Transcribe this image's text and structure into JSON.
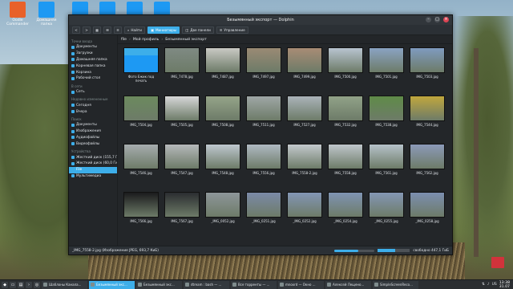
{
  "desktop": {
    "icons": [
      {
        "label": "Oodle Commander",
        "color": "#e8612a"
      },
      {
        "label": "Домашняя папка",
        "color": "#1d99f3"
      },
      {
        "label": "",
        "color": "#1d99f3"
      },
      {
        "label": "",
        "color": "#1d99f3"
      },
      {
        "label": "",
        "color": "#1d99f3"
      },
      {
        "label": "",
        "color": "#1d99f3"
      }
    ]
  },
  "window": {
    "title": "Безымянный экспорт — Dolphin",
    "toolbar": {
      "back": "<",
      "forward": ">",
      "find": "Найти",
      "preview": "Миниатюры",
      "split": "Две панели",
      "control": "Управление"
    },
    "breadcrumb": [
      "file",
      "Мой профиль",
      "Безымянный экспорт"
    ],
    "sidebar": [
      {
        "type": "head",
        "label": "Точки входа"
      },
      {
        "type": "item",
        "label": "Документы"
      },
      {
        "type": "item",
        "label": "Загрузки"
      },
      {
        "type": "item",
        "label": "Домашняя папка"
      },
      {
        "type": "item",
        "label": "Корневая папка"
      },
      {
        "type": "item",
        "label": "Корзина"
      },
      {
        "type": "item",
        "label": "Рабочий стол"
      },
      {
        "type": "head",
        "label": "В сети"
      },
      {
        "type": "item",
        "label": "Сеть"
      },
      {
        "type": "head",
        "label": "Недавно измененные"
      },
      {
        "type": "item",
        "label": "Сегодня"
      },
      {
        "type": "item",
        "label": "Вчера"
      },
      {
        "type": "head",
        "label": "Поиск"
      },
      {
        "type": "item",
        "label": "Документы"
      },
      {
        "type": "item",
        "label": "Изображения"
      },
      {
        "type": "item",
        "label": "Аудиофайлы"
      },
      {
        "type": "item",
        "label": "Видеофайлы"
      },
      {
        "type": "head",
        "label": "Устройства"
      },
      {
        "type": "item",
        "label": "Жесткий диск (155,7 ГиБ)"
      },
      {
        "type": "item",
        "label": "Жесткий диск (60,0 ГиБ)"
      },
      {
        "type": "item",
        "label": "File",
        "selected": true
      },
      {
        "type": "item",
        "label": "Мультимедиа"
      }
    ],
    "files": [
      {
        "name": "Фото Ежик под печать",
        "folder": true
      },
      {
        "name": "IMG_7478.jpg",
        "color": "#7f8a83"
      },
      {
        "name": "IMG_7487.jpg",
        "color": "#c9c9c4"
      },
      {
        "name": "IMG_7497.jpg",
        "color": "#9a8a74"
      },
      {
        "name": "IMG_7499.jpg",
        "color": "#a88c75"
      },
      {
        "name": "IMG_7500.jpg",
        "color": "#b8c4d0"
      },
      {
        "name": "IMG_7501.jpg",
        "color": "#8aa3c2"
      },
      {
        "name": "IMG_7503.jpg",
        "color": "#7f9bbf"
      },
      {
        "name": "IMG_7504.jpg",
        "color": "#6c8a5e"
      },
      {
        "name": "IMG_7505.jpg",
        "color": "#d6d7d8"
      },
      {
        "name": "IMG_7508.jpg",
        "color": "#95a489"
      },
      {
        "name": "IMG_7511.jpg",
        "color": "#9fa7a6"
      },
      {
        "name": "IMG_7527.jpg",
        "color": "#aab3b9"
      },
      {
        "name": "IMG_7532.jpg",
        "color": "#91a288"
      },
      {
        "name": "IMG_7538.jpg",
        "color": "#5f8b48"
      },
      {
        "name": "IMG_7544.jpg",
        "color": "#c0a73d"
      },
      {
        "name": "IMG_7546.jpg",
        "color": "#a6acae"
      },
      {
        "name": "IMG_7547.jpg",
        "color": "#b5b8ba"
      },
      {
        "name": "IMG_7548.jpg",
        "color": "#bec7cf"
      },
      {
        "name": "IMG_7556.jpg",
        "color": "#afb9c2"
      },
      {
        "name": "IMG_7558-2.jpg",
        "color": "#c3c9cd"
      },
      {
        "name": "IMG_7558.jpg",
        "color": "#bfc6cb"
      },
      {
        "name": "IMG_7561.jpg",
        "color": "#b6c2ca"
      },
      {
        "name": "IMG_7562.jpg",
        "color": "#8c9ab8"
      },
      {
        "name": "IMG_7566.jpg",
        "color": "#1b1b1d"
      },
      {
        "name": "IMG_7567.jpg",
        "color": "#2b2d30"
      },
      {
        "name": "_IMG_0052.jpg",
        "color": "#8e969a"
      },
      {
        "name": "_IMG_0251.jpg",
        "color": "#7b8aa7"
      },
      {
        "name": "_IMG_0252.jpg",
        "color": "#8396b5"
      },
      {
        "name": "_IMG_0254.jpg",
        "color": "#7f94b3"
      },
      {
        "name": "_IMG_0255.jpg",
        "color": "#8497b4"
      },
      {
        "name": "_IMG_0258.jpg",
        "color": "#7c8fb0"
      }
    ],
    "status": {
      "text": "_IMG_7558-2.jpg (Изображение JPEG, 693,7 КиБ)",
      "zoom": 0.6,
      "free_space": "свободно 447,1 ГиБ",
      "used_fraction": 0.55
    }
  },
  "taskbar": {
    "tasks": [
      {
        "label": "Шаблоны Канала..."
      },
      {
        "label": "Безымянный экс...",
        "active": true
      },
      {
        "label": "Безымянный экс..."
      },
      {
        "label": "dtream : bash — ..."
      },
      {
        "label": "Все торренты — ..."
      },
      {
        "label": "mnoxrd — Окно ..."
      },
      {
        "label": "Алексей Лещено..."
      },
      {
        "label": "SimpleScreenReco..."
      }
    ],
    "lang": "US",
    "time": "13:38",
    "date": "31.07"
  }
}
